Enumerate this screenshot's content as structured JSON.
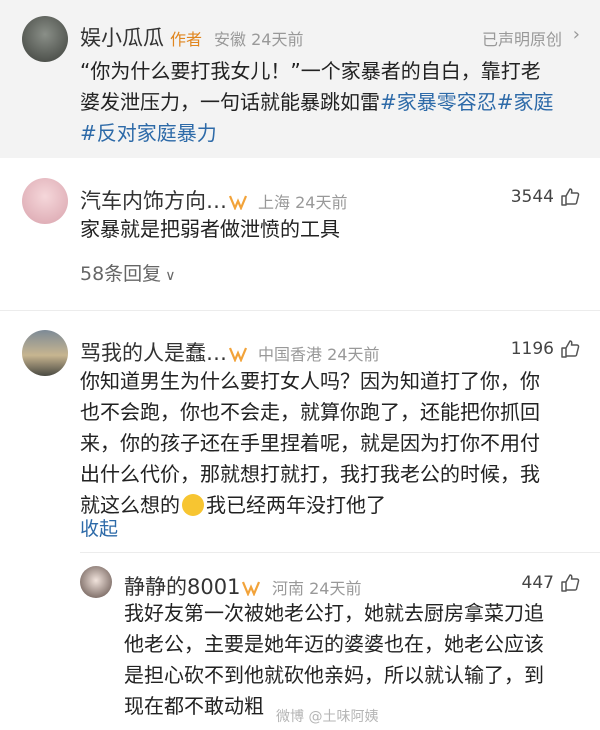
{
  "post": {
    "author": "娱小瓜瓜",
    "author_badge": "作者",
    "location_time": "安徽 24天前",
    "original_notice": "已声明原创",
    "lines": [
      "“你为什么要打我女儿！”一个家暴者的自白，靠打老",
      "婆发泄压力，一句话就能暴跳如雷"
    ],
    "tags": [
      "#家暴零容忍",
      "#家庭",
      "#反对家庭暴力"
    ]
  },
  "comments": [
    {
      "name": "汽车内饰方向…",
      "meta": "上海 24天前",
      "likes": "3544",
      "text": "家暴就是把弱者做泄愤的工具",
      "replies": "58条回复"
    },
    {
      "name": "骂我的人是蠢…",
      "meta": "中国香港 24天前",
      "likes": "1196",
      "lines": [
        "你知道男生为什么要打女人吗？因为知道打了你，你",
        "也不会跑，你也不会走，就算你跑了，还能把你抓回",
        "来，你的孩子还在手里捏着呢，就是因为打你不用付",
        "出什么代价，那就想打就打，我打我老公的时候，我",
        "就这么想的",
        "我已经两年没打他了"
      ],
      "collapse": "收起"
    },
    {
      "name": "静静的8001",
      "meta": "河南 24天前",
      "likes": "447",
      "lines": [
        "我好友第一次被她老公打，她就去厨房拿菜刀追",
        "他老公，主要是她年迈的婆婆也在，她老公应该",
        "是担心砍不到他就砍他亲妈，所以就认输了，到",
        "现在都不敢动粗"
      ]
    }
  ],
  "watermark": "微博 @土味阿姨",
  "colors": {
    "tag": "#2d6aa8",
    "vip": "#f2a33a"
  }
}
